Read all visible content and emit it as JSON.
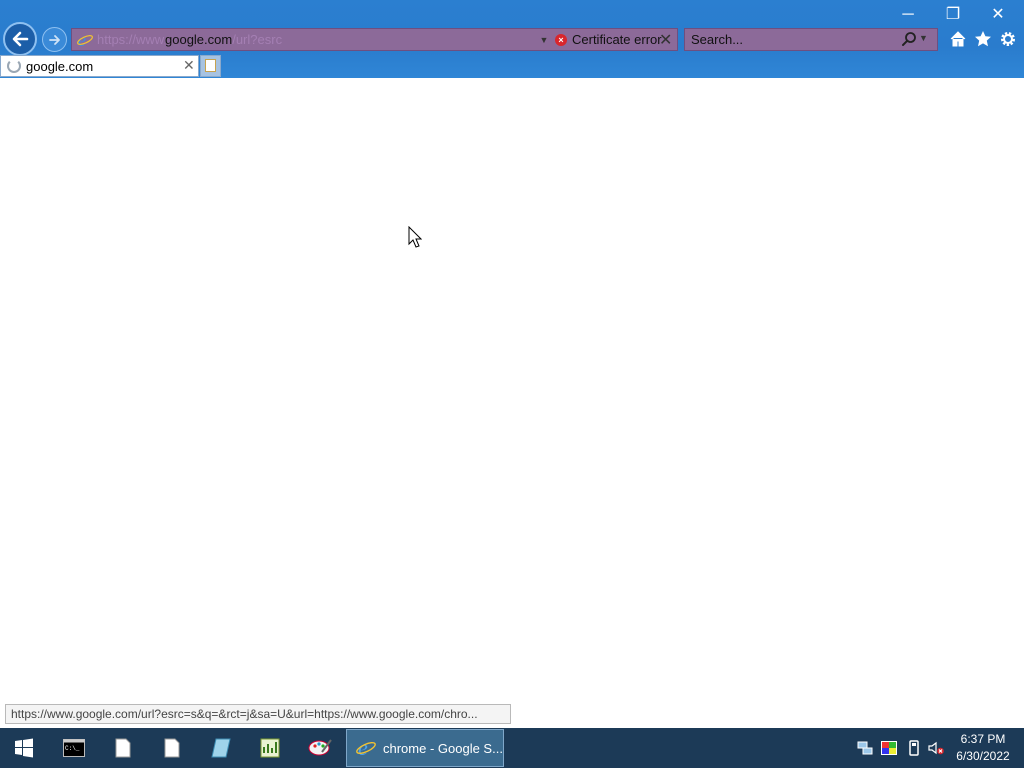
{
  "browser": {
    "address": {
      "url_prefix": "https://www.",
      "url_domain": "google.com",
      "url_suffix": "/url?esrc",
      "cert_label": "Certificate error"
    },
    "search": {
      "placeholder": "Search..."
    },
    "tab": {
      "title": "google.com"
    },
    "status_url": "https://www.google.com/url?esrc=s&q=&rct=j&sa=U&url=https://www.google.com/chro..."
  },
  "window_controls": {
    "minimize": "─",
    "restore": "❐",
    "close": "✕"
  },
  "taskbar": {
    "active_window_label": "chrome - Google S...",
    "clock_time": "6:37 PM",
    "clock_date": "6/30/2022"
  },
  "icons": [
    "back-arrow-icon",
    "forward-arrow-icon",
    "ie-icon",
    "dropdown-icon",
    "certificate-error-icon",
    "close-icon",
    "search-icon",
    "home-icon",
    "favorites-star-icon",
    "gear-icon",
    "loading-spinner-icon",
    "new-tab-icon",
    "windows-start-icon",
    "command-prompt-icon",
    "document-icon",
    "notepad-icon",
    "spreadsheet-icon",
    "paint-icon",
    "network-icon",
    "color-icon",
    "usb-icon",
    "volume-muted-icon"
  ],
  "colors": {
    "titlebar": "#2b7fd0",
    "address_error_bg": "#8c6a99",
    "taskbar": "#1c3a57",
    "cert_error_red": "#d9262c"
  }
}
